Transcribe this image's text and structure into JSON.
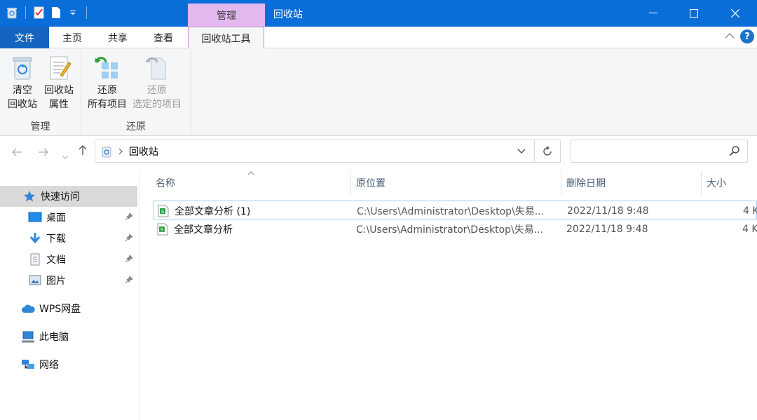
{
  "window": {
    "title": "回收站",
    "context_tab": "管理"
  },
  "tabs": {
    "file": "文件",
    "home": "主页",
    "share": "共享",
    "view": "查看",
    "recycle_tools": "回收站工具"
  },
  "ribbon": {
    "manage": {
      "label": "管理",
      "empty_line1": "清空",
      "empty_line2": "回收站",
      "props_line1": "回收站",
      "props_line2": "属性"
    },
    "restore": {
      "label": "还原",
      "all_line1": "还原",
      "all_line2": "所有项目",
      "sel_line1": "还原",
      "sel_line2": "选定的项目"
    }
  },
  "address": {
    "path": "回收站",
    "search_placeholder": ""
  },
  "sidebar": {
    "quick_access": "快速访问",
    "desktop": "桌面",
    "downloads": "下载",
    "documents": "文档",
    "pictures": "图片",
    "wps": "WPS网盘",
    "this_pc": "此电脑",
    "network": "网络"
  },
  "columns": {
    "name": "名称",
    "location": "原位置",
    "deleted": "删除日期",
    "size": "大小"
  },
  "files": [
    {
      "name": "全部文章分析 (1)",
      "location": "C:\\Users\\Administrator\\Desktop\\失易...",
      "deleted": "2022/11/18 9:48",
      "size": "4 K"
    },
    {
      "name": "全部文章分析",
      "location": "C:\\Users\\Administrator\\Desktop\\失易...",
      "deleted": "2022/11/18 9:48",
      "size": "4 K"
    }
  ],
  "colors": {
    "titlebar": "#0a6ed8",
    "context": "#e3b8ef",
    "file_tab": "#1565c0"
  }
}
